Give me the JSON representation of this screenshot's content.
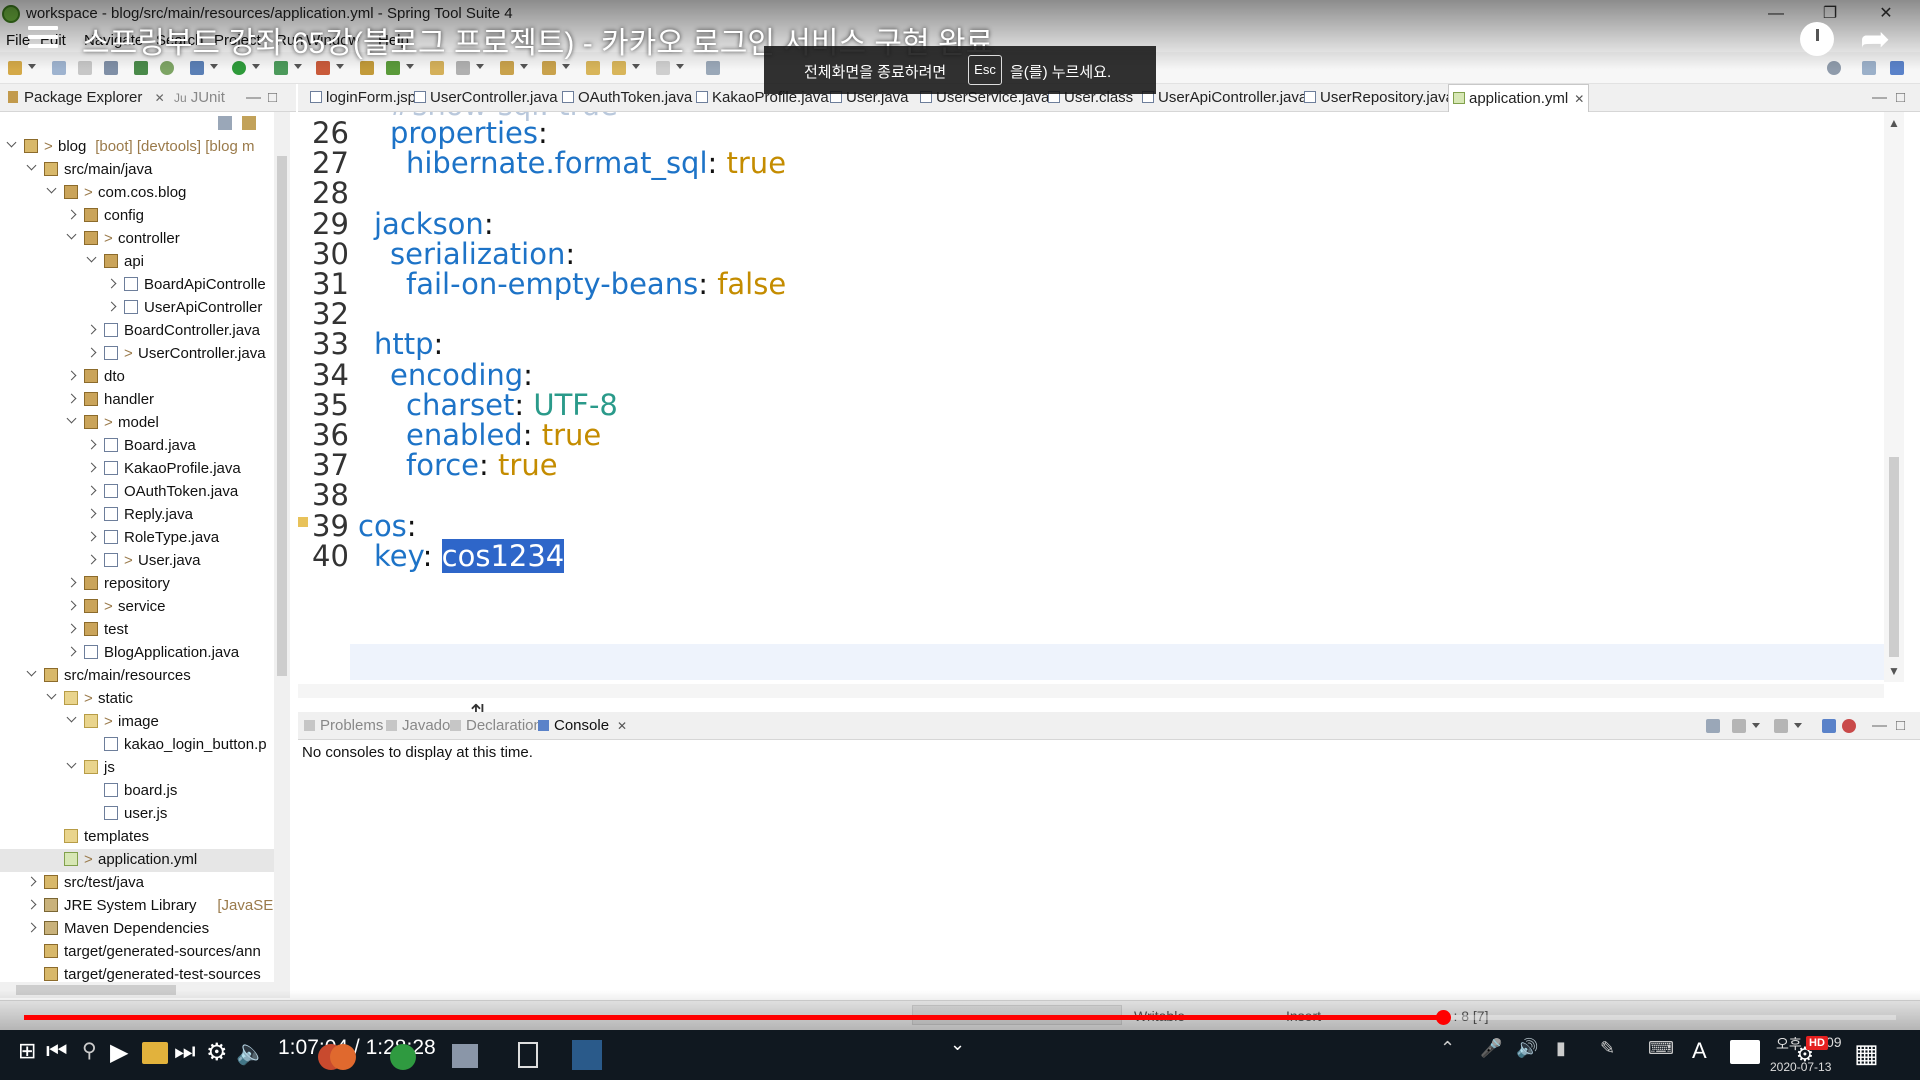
{
  "window": {
    "title": "workspace - blog/src/main/resources/application.yml - Spring Tool Suite 4"
  },
  "menu": [
    "File",
    "Edit",
    "Navigate",
    "Search",
    "Project",
    "Run",
    "Window",
    "Help"
  ],
  "video": {
    "title": "스프링부트 강좌 65강(블로그 프로젝트) - 카카오 로그인 서비스 구현 완료",
    "esc_before": "전체화면을 종료하려면",
    "esc_key": "Esc",
    "esc_after": "을(를) 누르세요.",
    "time_current": "1:07:04",
    "time_sep": "/",
    "time_total": "1:28:28",
    "progress_fraction": 0.758,
    "hd": "HD"
  },
  "package_explorer": {
    "tab_label": "Package Explorer",
    "junit_label": "JUnit",
    "tree": [
      {
        "label": "blog",
        "suffix": "[boot] [devtools] [blog m",
        "depth": 0,
        "toggle": "open",
        "icon": "src",
        "dec": true
      },
      {
        "label": "src/main/java",
        "depth": 1,
        "toggle": "open",
        "icon": "src"
      },
      {
        "label": "com.cos.blog",
        "depth": 2,
        "toggle": "open",
        "icon": "pkg",
        "dec": true
      },
      {
        "label": "config",
        "depth": 3,
        "toggle": "closed",
        "icon": "pkg"
      },
      {
        "label": "controller",
        "depth": 3,
        "toggle": "open",
        "icon": "pkg",
        "dec": true
      },
      {
        "label": "api",
        "depth": 4,
        "toggle": "open",
        "icon": "pkg"
      },
      {
        "label": "BoardApiControlle",
        "depth": 5,
        "toggle": "closed",
        "icon": "java"
      },
      {
        "label": "UserApiController",
        "depth": 5,
        "toggle": "closed",
        "icon": "java"
      },
      {
        "label": "BoardController.java",
        "depth": 4,
        "toggle": "closed",
        "icon": "java"
      },
      {
        "label": "UserController.java",
        "depth": 4,
        "toggle": "closed",
        "icon": "java",
        "dec": true
      },
      {
        "label": "dto",
        "depth": 3,
        "toggle": "closed",
        "icon": "pkg"
      },
      {
        "label": "handler",
        "depth": 3,
        "toggle": "closed",
        "icon": "pkg"
      },
      {
        "label": "model",
        "depth": 3,
        "toggle": "open",
        "icon": "pkg",
        "dec": true
      },
      {
        "label": "Board.java",
        "depth": 4,
        "toggle": "closed",
        "icon": "java"
      },
      {
        "label": "KakaoProfile.java",
        "depth": 4,
        "toggle": "closed",
        "icon": "java"
      },
      {
        "label": "OAuthToken.java",
        "depth": 4,
        "toggle": "closed",
        "icon": "java"
      },
      {
        "label": "Reply.java",
        "depth": 4,
        "toggle": "closed",
        "icon": "java"
      },
      {
        "label": "RoleType.java",
        "depth": 4,
        "toggle": "closed",
        "icon": "java"
      },
      {
        "label": "User.java",
        "depth": 4,
        "toggle": "closed",
        "icon": "java",
        "dec": true
      },
      {
        "label": "repository",
        "depth": 3,
        "toggle": "closed",
        "icon": "pkg"
      },
      {
        "label": "service",
        "depth": 3,
        "toggle": "closed",
        "icon": "pkg",
        "dec": true
      },
      {
        "label": "test",
        "depth": 3,
        "toggle": "closed",
        "icon": "pkg"
      },
      {
        "label": "BlogApplication.java",
        "depth": 3,
        "toggle": "closed",
        "icon": "java"
      },
      {
        "label": "src/main/resources",
        "depth": 1,
        "toggle": "open",
        "icon": "src"
      },
      {
        "label": "static",
        "depth": 2,
        "toggle": "open",
        "icon": "folder",
        "dec": true
      },
      {
        "label": "image",
        "depth": 3,
        "toggle": "open",
        "icon": "folder",
        "dec": true
      },
      {
        "label": "kakao_login_button.p",
        "depth": 4,
        "toggle": "none",
        "icon": "java"
      },
      {
        "label": "js",
        "depth": 3,
        "toggle": "open",
        "icon": "folder"
      },
      {
        "label": "board.js",
        "depth": 4,
        "toggle": "none",
        "icon": "java"
      },
      {
        "label": "user.js",
        "depth": 4,
        "toggle": "none",
        "icon": "java"
      },
      {
        "label": "templates",
        "depth": 2,
        "toggle": "none",
        "icon": "folder"
      },
      {
        "label": "application.yml",
        "depth": 2,
        "toggle": "none",
        "icon": "yml",
        "dec": true,
        "selected": true
      },
      {
        "label": "src/test/java",
        "depth": 1,
        "toggle": "closed",
        "icon": "src"
      },
      {
        "label": "JRE System Library",
        "suffix": "[JavaSE-1.8",
        "depth": 1,
        "toggle": "closed",
        "icon": "lib"
      },
      {
        "label": "Maven Dependencies",
        "depth": 1,
        "toggle": "closed",
        "icon": "lib"
      },
      {
        "label": "target/generated-sources/ann",
        "depth": 1,
        "toggle": "none",
        "icon": "src"
      },
      {
        "label": "target/generated-test-sources",
        "depth": 1,
        "toggle": "none",
        "icon": "src"
      }
    ]
  },
  "editor": {
    "tabs": [
      {
        "label": "loginForm.jsp"
      },
      {
        "label": "UserController.java"
      },
      {
        "label": "OAuthToken.java"
      },
      {
        "label": "KakaoProfile.java"
      },
      {
        "label": "User.java"
      },
      {
        "label": "UserService.java"
      },
      {
        "label": "User.class"
      },
      {
        "label": "UserApiController.java"
      },
      {
        "label": "UserRepository.java"
      },
      {
        "label": "application.yml",
        "active": true
      }
    ],
    "lines": [
      {
        "num": "26",
        "indent": 2,
        "tokens": [
          {
            "t": "properties",
            "c": "k"
          },
          {
            "t": ":",
            "c": "p"
          }
        ]
      },
      {
        "num": "27",
        "indent": 3,
        "tokens": [
          {
            "t": "hibernate.format_sql",
            "c": "k"
          },
          {
            "t": ": ",
            "c": "p"
          },
          {
            "t": "true",
            "c": "vb"
          }
        ]
      },
      {
        "num": "28",
        "indent": 0,
        "tokens": []
      },
      {
        "num": "29",
        "indent": 1,
        "tokens": [
          {
            "t": "jackson",
            "c": "k"
          },
          {
            "t": ":",
            "c": "p"
          }
        ]
      },
      {
        "num": "30",
        "indent": 2,
        "tokens": [
          {
            "t": "serialization",
            "c": "k"
          },
          {
            "t": ":",
            "c": "p"
          }
        ]
      },
      {
        "num": "31",
        "indent": 3,
        "tokens": [
          {
            "t": "fail-on-empty-beans",
            "c": "k"
          },
          {
            "t": ": ",
            "c": "p"
          },
          {
            "t": "false",
            "c": "vb"
          }
        ]
      },
      {
        "num": "32",
        "indent": 0,
        "tokens": []
      },
      {
        "num": "33",
        "indent": 1,
        "tokens": [
          {
            "t": "http",
            "c": "k"
          },
          {
            "t": ":",
            "c": "p"
          }
        ]
      },
      {
        "num": "34",
        "indent": 2,
        "tokens": [
          {
            "t": "encoding",
            "c": "k"
          },
          {
            "t": ":",
            "c": "p"
          }
        ]
      },
      {
        "num": "35",
        "indent": 3,
        "tokens": [
          {
            "t": "charset",
            "c": "k"
          },
          {
            "t": ": ",
            "c": "p"
          },
          {
            "t": "UTF-8",
            "c": "vs"
          }
        ]
      },
      {
        "num": "36",
        "indent": 3,
        "tokens": [
          {
            "t": "enabled",
            "c": "k"
          },
          {
            "t": ": ",
            "c": "p"
          },
          {
            "t": "true",
            "c": "vb"
          }
        ]
      },
      {
        "num": "37",
        "indent": 3,
        "tokens": [
          {
            "t": "force",
            "c": "k"
          },
          {
            "t": ": ",
            "c": "p"
          },
          {
            "t": "true",
            "c": "vb"
          }
        ]
      },
      {
        "num": "38",
        "indent": 0,
        "tokens": []
      },
      {
        "num": "39",
        "indent": 0,
        "tokens": [
          {
            "t": "cos",
            "c": "k"
          },
          {
            "t": ":",
            "c": "p"
          }
        ]
      },
      {
        "num": "40",
        "indent": 1,
        "tokens": [
          {
            "t": "key",
            "c": "k"
          },
          {
            "t": ": ",
            "c": "p"
          },
          {
            "t": "cos1234",
            "c": "sel"
          }
        ]
      }
    ]
  },
  "bottom_panel": {
    "tabs": [
      {
        "label": "Problems"
      },
      {
        "label": "Javadoc"
      },
      {
        "label": "Declaration"
      },
      {
        "label": "Console",
        "active": true
      }
    ],
    "message": "No consoles to display at this time."
  },
  "status": {
    "writable": "Writable",
    "insert": "Insert",
    "position": "40 : 8 [7]"
  },
  "tray": {
    "ampm": "오후",
    "time": "09",
    "date": "2020-07-13"
  },
  "colors": {
    "key": "#1d73c7",
    "bool": "#c48c00",
    "string": "#2a9a8a",
    "selection": "#2e66c9",
    "progress": "#ff0000"
  }
}
